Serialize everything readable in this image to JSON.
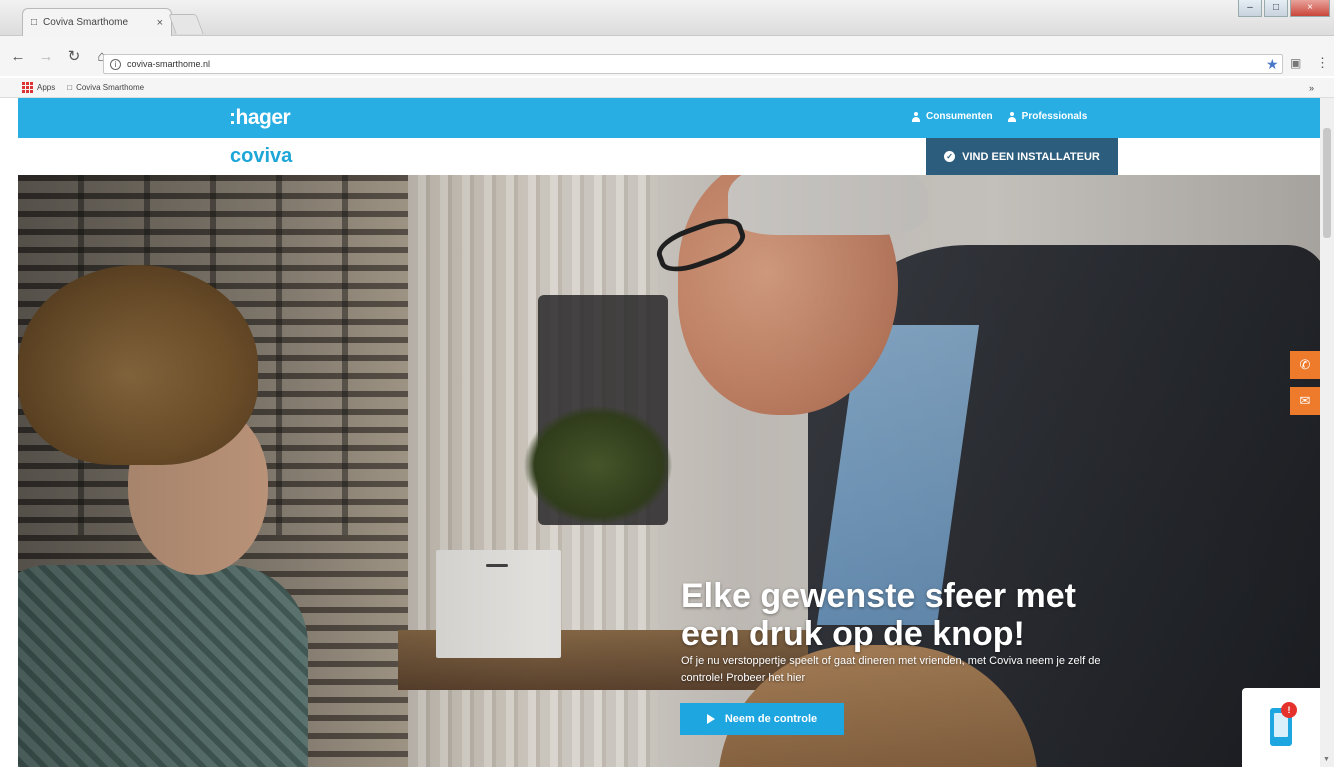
{
  "browser": {
    "tab_title": "Coviva Smarthome",
    "tab_close": "×",
    "url": "coviva-smarthome.nl",
    "bookmarks": {
      "apps_label": "Apps",
      "item_label": "Coviva Smarthome",
      "more": "»"
    },
    "nav": {
      "back": "←",
      "forward": "→",
      "reload": "↻",
      "home": "⌂"
    }
  },
  "site": {
    "brand_hager": ":hager",
    "brand_coviva": "coviva",
    "top_links": [
      {
        "label": "Consumenten",
        "icon": "person-icon"
      },
      {
        "label": "Professionals",
        "icon": "person-icon"
      }
    ],
    "installer_button": "VIND EEN INSTALLATEUR",
    "hero": {
      "title": "Elke gewenste sfeer met een druk op de knop!",
      "description": "Of je nu verstoppertje speelt of gaat dineren met vrienden, met Coviva neem je zelf de controle! Probeer het hier",
      "cta_label": "Neem de controle"
    },
    "side_contact": {
      "phone_icon": "phone-icon",
      "mail_icon": "mail-icon"
    },
    "app_widget": {
      "badge": "!"
    }
  },
  "colors": {
    "brand_blue": "#29aee3",
    "installer_bg": "#2d5d7c",
    "contact_orange": "#ee7a2b",
    "cta_blue": "#1ea6e0"
  }
}
